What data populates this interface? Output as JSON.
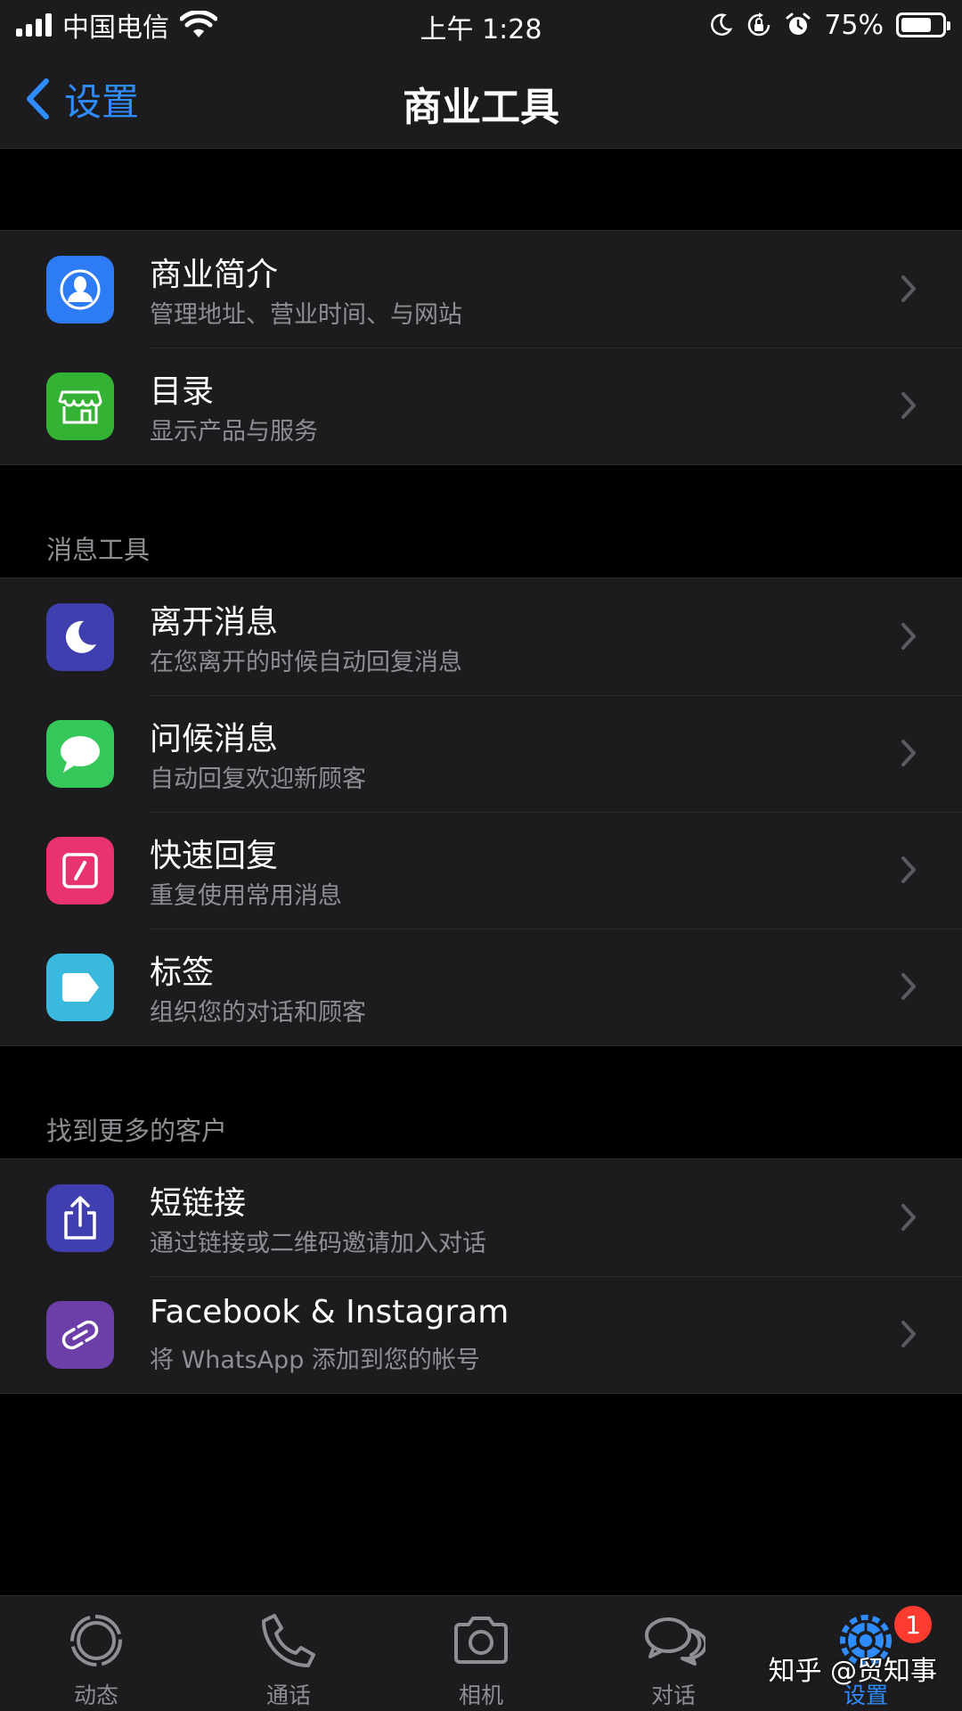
{
  "status_bar": {
    "carrier": "中国电信",
    "time": "上午 1:28",
    "battery": "75%",
    "battery_level": 0.75,
    "icons": [
      "signal-icon",
      "wifi-icon",
      "moon-icon",
      "rotation-lock-icon",
      "alarm-icon",
      "battery-icon"
    ]
  },
  "nav": {
    "back_label": "设置",
    "title": "商业工具"
  },
  "groups": [
    {
      "header": "",
      "items": [
        {
          "title": "商业简介",
          "subtitle": "管理地址、营业时间、与网站",
          "icon": "person-icon",
          "color": "#2d7cf6"
        },
        {
          "title": "目录",
          "subtitle": "显示产品与服务",
          "icon": "storefront-icon",
          "color": "#34b233"
        }
      ]
    },
    {
      "header": "消息工具",
      "items": [
        {
          "title": "离开消息",
          "subtitle": "在您离开的时候自动回复消息",
          "icon": "moon-icon",
          "color": "#3f3fb0"
        },
        {
          "title": "问候消息",
          "subtitle": "自动回复欢迎新顾客",
          "icon": "chat-bubble-icon",
          "color": "#35c75a"
        },
        {
          "title": "快速回复",
          "subtitle": "重复使用常用消息",
          "icon": "quick-reply-icon",
          "color": "#e8336f"
        },
        {
          "title": "标签",
          "subtitle": "组织您的对话和顾客",
          "icon": "tag-icon",
          "color": "#39b9de"
        }
      ]
    },
    {
      "header": "找到更多的客户",
      "items": [
        {
          "title": "短链接",
          "subtitle": "通过链接或二维码邀请加入对话",
          "icon": "share-icon",
          "color": "#3f3fb0"
        },
        {
          "title": "Facebook & Instagram",
          "subtitle": "将 WhatsApp 添加到您的帐号",
          "icon": "link-icon",
          "color": "#6b3ea8"
        }
      ]
    }
  ],
  "tab_bar": {
    "tabs": [
      {
        "label": "动态",
        "icon": "status-icon",
        "active": false
      },
      {
        "label": "通话",
        "icon": "phone-icon",
        "active": false
      },
      {
        "label": "相机",
        "icon": "camera-icon",
        "active": false
      },
      {
        "label": "对话",
        "icon": "chats-icon",
        "active": false
      },
      {
        "label": "设置",
        "icon": "gear-icon",
        "active": true,
        "badge": "1"
      }
    ]
  },
  "watermark": {
    "text": "知乎 @贸知事"
  },
  "colors": {
    "accent": "#2f8cff",
    "background": "#000000",
    "cell": "#1c1c1e",
    "secondary_text": "#8e8e93",
    "badge": "#ff3b30"
  }
}
